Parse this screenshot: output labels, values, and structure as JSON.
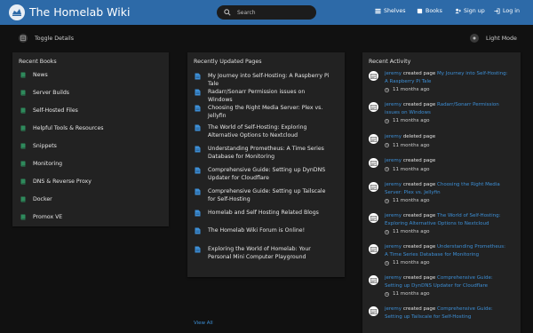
{
  "header": {
    "title": "The Homelab Wiki",
    "search_placeholder": "Search",
    "nav": [
      {
        "label": "Shelves",
        "icon": "shelves-icon"
      },
      {
        "label": "Books",
        "icon": "books-icon"
      },
      {
        "label": "Sign up",
        "icon": "sign-up-icon"
      },
      {
        "label": "Log in",
        "icon": "log-in-icon"
      }
    ]
  },
  "toolbar": {
    "toggle_details": "Toggle Details",
    "light_mode": "Light Mode"
  },
  "recent_books": {
    "title": "Recent Books",
    "items": [
      "News",
      "Server Builds",
      "Self-Hosted Files",
      "Helpful Tools & Resources",
      "Snippets",
      "Monitoring",
      "DNS & Reverse Proxy",
      "Docker",
      "Promox VE"
    ]
  },
  "recent_pages": {
    "title": "Recently Updated Pages",
    "items": [
      "My Journey into Self-Hosting: A Raspberry Pi Tale",
      "Radarr/Sonarr Permission issues on Windows",
      "Choosing the Right Media Server: Plex vs. Jellyfin",
      "The World of Self-Hosting: Exploring Alternative Options to Nextcloud",
      "Understanding Prometheus: A Time Series Database for Monitoring",
      "Comprehensive Guide: Setting up DynDNS Updater for Cloudflare",
      "Comprehensive Guide: Setting up Tailscale for Self-Hosting",
      "Homelab and Self Hosting Related Blogs",
      "The Homelab Wiki Forum is Online!",
      "Exploring the World of Homelab: Your Personal Mini Computer Playground"
    ],
    "view_all": "View All"
  },
  "recent_activity": {
    "title": "Recent Activity",
    "items": [
      {
        "user": "jeremy",
        "action": "created page",
        "target": "My Journey into Self-Hosting: A Raspberry Pi Tale",
        "time": "11 months ago"
      },
      {
        "user": "jeremy",
        "action": "created page",
        "target": "Radarr/Sonarr Permission issues on Windows",
        "time": "11 months ago"
      },
      {
        "user": "jeremy",
        "action": "deleted page",
        "target": "",
        "time": "11 months ago"
      },
      {
        "user": "jeremy",
        "action": "created page",
        "target": "",
        "time": "11 months ago"
      },
      {
        "user": "jeremy",
        "action": "created page",
        "target": "Choosing the Right Media Server: Plex vs. Jellyfin",
        "time": "11 months ago"
      },
      {
        "user": "jeremy",
        "action": "created page",
        "target": "The World of Self-Hosting: Exploring Alternative Options to Nextcloud",
        "time": "11 months ago"
      },
      {
        "user": "jeremy",
        "action": "created page",
        "target": "Understanding Prometheus: A Time Series Database for Monitoring",
        "time": "11 months ago"
      },
      {
        "user": "jeremy",
        "action": "created page",
        "target": "Comprehensive Guide: Setting up DynDNS Updater for Cloudflare",
        "time": "11 months ago"
      },
      {
        "user": "jeremy",
        "action": "created page",
        "target": "Comprehensive Guide: Setting up Tailscale for Self-Hosting",
        "time": ""
      }
    ]
  },
  "colors": {
    "header": "#2d6aa8",
    "background": "#111111",
    "panel": "#222222",
    "book_icon": "#2f8a5c",
    "page_icon": "#3d8fd6",
    "link": "#3d8fd6"
  }
}
